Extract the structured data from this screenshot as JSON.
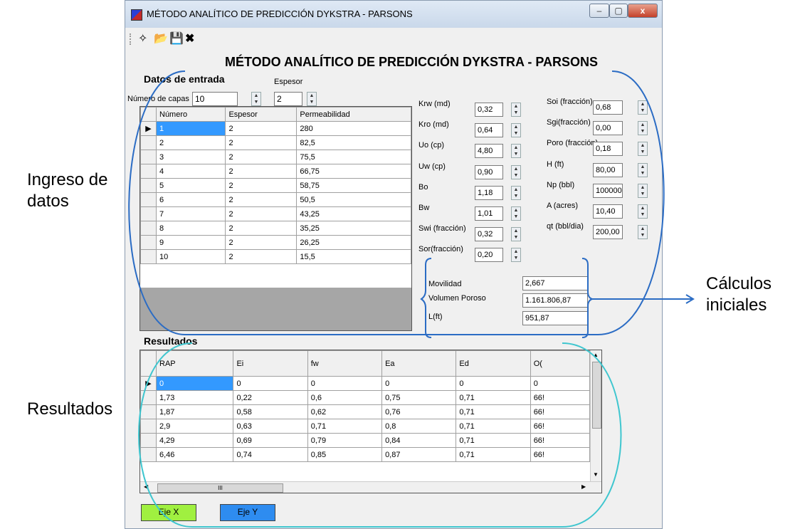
{
  "window": {
    "title": "MÉTODO ANALÍTICO DE PREDICCIÓN DYKSTRA - PARSONS",
    "min": "–",
    "max": "▢",
    "close": "x"
  },
  "toolbar": {
    "new_icon": "✧",
    "open_icon": "📂",
    "save_icon": "💾",
    "delete_icon": "✖"
  },
  "main_title": "MÉTODO ANALÍTICO DE PREDICCIÓN DYKSTRA - PARSONS",
  "input": {
    "section_label": "Datos de entrada",
    "thickness_label": "Espesor",
    "layers_label": "Número de capas",
    "layers_value": "10",
    "thickness_value": "2",
    "columns": [
      "Número",
      "Espesor",
      "Permeabilidad"
    ],
    "rows": [
      [
        "1",
        "2",
        "280"
      ],
      [
        "2",
        "2",
        "82,5"
      ],
      [
        "3",
        "2",
        "75,5"
      ],
      [
        "4",
        "2",
        "66,75"
      ],
      [
        "5",
        "2",
        "58,75"
      ],
      [
        "6",
        "2",
        "50,5"
      ],
      [
        "7",
        "2",
        "43,25"
      ],
      [
        "8",
        "2",
        "35,25"
      ],
      [
        "9",
        "2",
        "26,25"
      ],
      [
        "10",
        "2",
        "15,5"
      ]
    ]
  },
  "params_left": [
    {
      "label": "Krw (md)",
      "value": "0,32"
    },
    {
      "label": "Kro (md)",
      "value": "0,64"
    },
    {
      "label": "Uo (cp)",
      "value": "4,80"
    },
    {
      "label": "Uw (cp)",
      "value": "0,90"
    },
    {
      "label": "Bo",
      "value": "1,18"
    },
    {
      "label": "Bw",
      "value": "1,01"
    },
    {
      "label": "Swi (fracción)",
      "value": "0,32"
    },
    {
      "label": "Sor(fracción)",
      "value": "0,20"
    }
  ],
  "params_right": [
    {
      "label": "Soi (fracción)",
      "value": "0,68"
    },
    {
      "label": "Sgi(fracción)",
      "value": "0,00"
    },
    {
      "label": "Poro (fracción)",
      "value": "0,18"
    },
    {
      "label": "H (ft)",
      "value": "80,00"
    },
    {
      "label": "Np (bbl)",
      "value": "100000"
    },
    {
      "label": "A (acres)",
      "value": "10,40"
    },
    {
      "label": "qt (bbl/dia)",
      "value": "200,00"
    }
  ],
  "initial": [
    {
      "label": "Movilidad",
      "value": "2,667"
    },
    {
      "label": "Volumen Poroso",
      "value": "1.161.806,87"
    },
    {
      "label": "L(ft)",
      "value": "951,87"
    }
  ],
  "results": {
    "section_label": "Resultados",
    "columns": [
      "RAP",
      "Ei",
      "fw",
      "Ea",
      "Ed",
      "O("
    ],
    "rows": [
      [
        "0",
        "0",
        "0",
        "0",
        "0",
        "0"
      ],
      [
        "1,73",
        "0,22",
        "0,6",
        "0,75",
        "0,71",
        "66!"
      ],
      [
        "1,87",
        "0,58",
        "0,62",
        "0,76",
        "0,71",
        "66!"
      ],
      [
        "2,9",
        "0,63",
        "0,71",
        "0,8",
        "0,71",
        "66!"
      ],
      [
        "4,29",
        "0,69",
        "0,79",
        "0,84",
        "0,71",
        "66!"
      ],
      [
        "6,46",
        "0,74",
        "0,85",
        "0,87",
        "0,71",
        "66!"
      ]
    ],
    "hscroll_grip": "III"
  },
  "buttons": {
    "x_axis": "Eje X",
    "y_axis": "Eje Y"
  },
  "annotations": {
    "ingreso": [
      "Ingreso de",
      "datos"
    ],
    "calculos": [
      "Cálculos",
      "iniciales"
    ],
    "resultados": "Resultados"
  },
  "colors": {
    "selected": "#3399ff",
    "annot_blue": "#2b6cc4",
    "annot_cyan": "#3fc6cf",
    "btn_x": "#a0f040",
    "btn_y": "#2e8cf0"
  }
}
